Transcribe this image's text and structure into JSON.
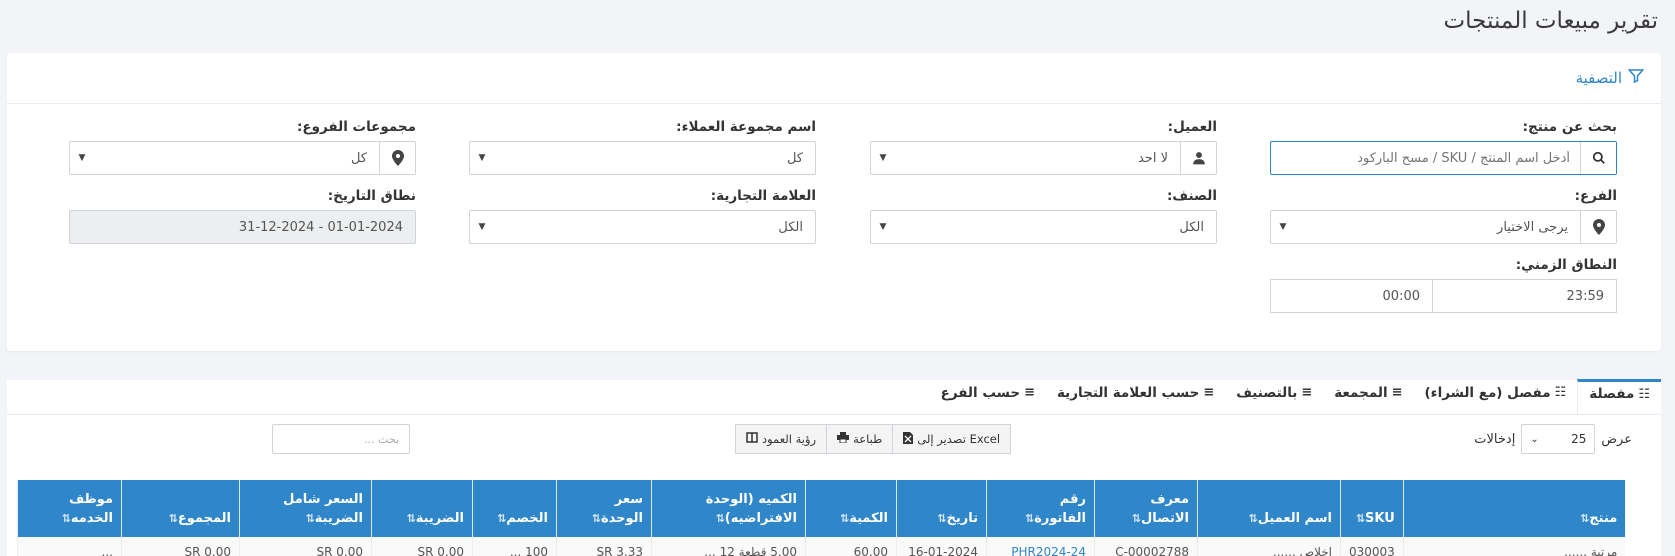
{
  "page": {
    "title": "تقرير مبيعات المنتجات"
  },
  "filters": {
    "header_label": "التصفية",
    "product_search": {
      "label": "بحث عن منتج:",
      "placeholder": "أدخل اسم المنتج / SKU / مسح الباركود"
    },
    "customer": {
      "label": "العميل:",
      "value": "لا احد"
    },
    "customer_group": {
      "label": "اسم مجموعة العملاء:",
      "value": "كل"
    },
    "branch_groups": {
      "label": "مجموعات الفروع:",
      "value": "كل"
    },
    "branch": {
      "label": "الفرع:",
      "value": "يرجى الاختيار"
    },
    "category": {
      "label": "الصنف:",
      "value": "الكل"
    },
    "brand": {
      "label": "العلامة التجارية:",
      "value": "الكل"
    },
    "date_range": {
      "label": "نطاق التاريخ:",
      "value": "01-01-2024 - 31-12-2024"
    },
    "time_range": {
      "label": "النطاق الزمني:",
      "from": "23:59",
      "to": "00:00"
    }
  },
  "tabs": [
    {
      "label": "مفصلة",
      "icon": "list-icon",
      "active": true
    },
    {
      "label": "مفصل (مع الشراء)",
      "icon": "list-icon"
    },
    {
      "label": "المجمعة",
      "icon": "bars-icon"
    },
    {
      "label": "بالتصنيف",
      "icon": "bars-icon"
    },
    {
      "label": "حسب العلامة التجارية",
      "icon": "bars-icon"
    },
    {
      "label": "حسب الفرع",
      "icon": "bars-icon"
    }
  ],
  "toolbar": {
    "show_label": "عرض",
    "entries_label": "إدخالات",
    "page_length": "25",
    "export_excel": "تصدير إلى Excel",
    "print": "طباعة",
    "column_visibility": "رؤية العمود",
    "search_placeholder": "بحث ..."
  },
  "table": {
    "columns": [
      {
        "l1": "",
        "l2": "منتج",
        "w": 222
      },
      {
        "l1": "",
        "l2": "SKU",
        "w": 58
      },
      {
        "l1": "",
        "l2": "اسم العميل",
        "w": 143
      },
      {
        "l1": "معرف",
        "l2": "الاتصال",
        "w": 103
      },
      {
        "l1": "رقم",
        "l2": "الفاتورة",
        "w": 108
      },
      {
        "l1": "",
        "l2": "تاريخ",
        "w": 90
      },
      {
        "l1": "",
        "l2": "الكمية",
        "w": 91
      },
      {
        "l1": "الكميه (الوحدة",
        "l2": "الافتراضيه)",
        "w": 154
      },
      {
        "l1": "سعر",
        "l2": "الوحدة",
        "w": 95
      },
      {
        "l1": "",
        "l2": "الخصم",
        "w": 84
      },
      {
        "l1": "",
        "l2": "الضريبة",
        "w": 101
      },
      {
        "l1": "السعر شامل",
        "l2": "الضريبة",
        "w": 132
      },
      {
        "l1": "",
        "l2": "المجموع",
        "w": 118
      },
      {
        "l1": "موظف",
        "l2": "الخدمه",
        "w": 104
      }
    ],
    "rows": [
      [
        "مرتبة ......",
        "030003",
        "اخلاص ......",
        "C-00002788",
        "PHR2024-24",
        "16-01-2024",
        "60.00",
        "5.00 قطعة 12 ...",
        "SR 3.33",
        "100 ...",
        "SR 0.00",
        "SR 0.00",
        "SR 0.00",
        "..."
      ]
    ]
  },
  "colors": {
    "accent": "#2f86c8",
    "header_text": "#ffffff"
  }
}
